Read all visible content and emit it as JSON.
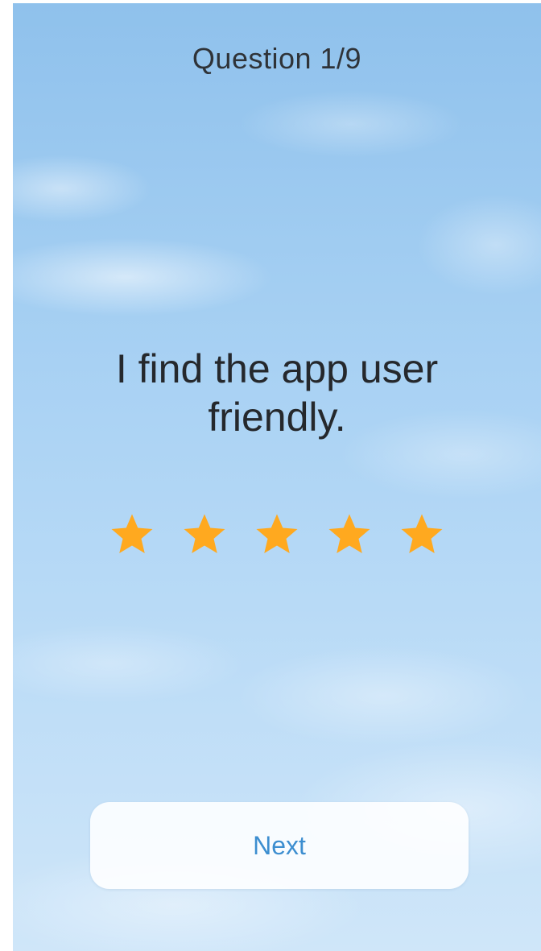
{
  "header": {
    "question_counter": "Question 1/9"
  },
  "question": {
    "text": "I find the app user friendly."
  },
  "rating": {
    "max_stars": 5,
    "selected": 5,
    "star_color": "#ffa91f",
    "stars": [
      {
        "label": "1 star",
        "icon": "star-icon"
      },
      {
        "label": "2 stars",
        "icon": "star-icon"
      },
      {
        "label": "3 stars",
        "icon": "star-icon"
      },
      {
        "label": "4 stars",
        "icon": "star-icon"
      },
      {
        "label": "5 stars",
        "icon": "star-icon"
      }
    ]
  },
  "footer": {
    "next_label": "Next",
    "next_color": "#3d8ed0"
  },
  "theme": {
    "background": "sky-with-clouds",
    "text_color": "#25282c"
  }
}
